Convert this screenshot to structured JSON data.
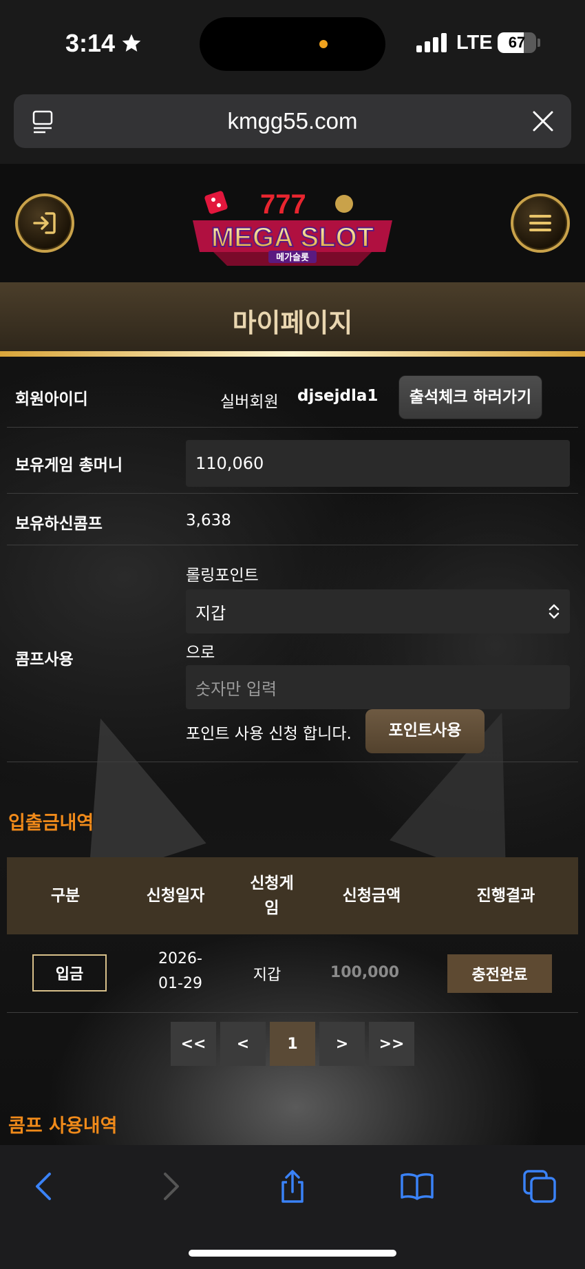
{
  "status_bar": {
    "time": "3:14",
    "network": "LTE",
    "battery_level": "67",
    "battery_fraction": 0.67,
    "signal_bars": 4
  },
  "browser": {
    "url": "kmgg55.com"
  },
  "site": {
    "logo_text": "MEGA SLOT",
    "logo_subtext": "메가슬롯",
    "page_title": "마이페이지"
  },
  "member": {
    "id_label": "회원아이디",
    "grade": "실버회원",
    "user_id": "djsejdla1",
    "attendance_button": "출석체크 하러가기",
    "money_label": "보유게임 총머니",
    "money_value": "110,060",
    "comp_label": "보유하신콤프",
    "comp_value": "3,638"
  },
  "comp_use": {
    "label": "콤프사용",
    "rolling_label": "롤링포인트",
    "wallet_select": "지갑",
    "suffix_text": "으로",
    "amount_placeholder": "숫자만 입력",
    "request_text": "포인트 사용 신청 합니다.",
    "use_button": "포인트사용"
  },
  "history": {
    "title": "입출금내역",
    "columns": [
      "구분",
      "신청일자",
      "신청게임",
      "신청금액",
      "진행결과"
    ],
    "col3_line1": "신청게",
    "col3_line2": "임",
    "rows": [
      {
        "type": "입금",
        "date_line1": "2026-",
        "date_line2": "01-29",
        "game": "지갑",
        "amount": "100,000",
        "result": "충전완료"
      }
    ]
  },
  "pagination": {
    "first": "<<",
    "prev": "<",
    "current": "1",
    "next": ">",
    "last": ">>"
  },
  "comp_history": {
    "title": "콤프 사용내역"
  },
  "colors": {
    "gold": "#c9a24a",
    "section_orange": "#f08a1a",
    "table_header": "#3f3424",
    "ios_blue": "#3a82f7"
  }
}
